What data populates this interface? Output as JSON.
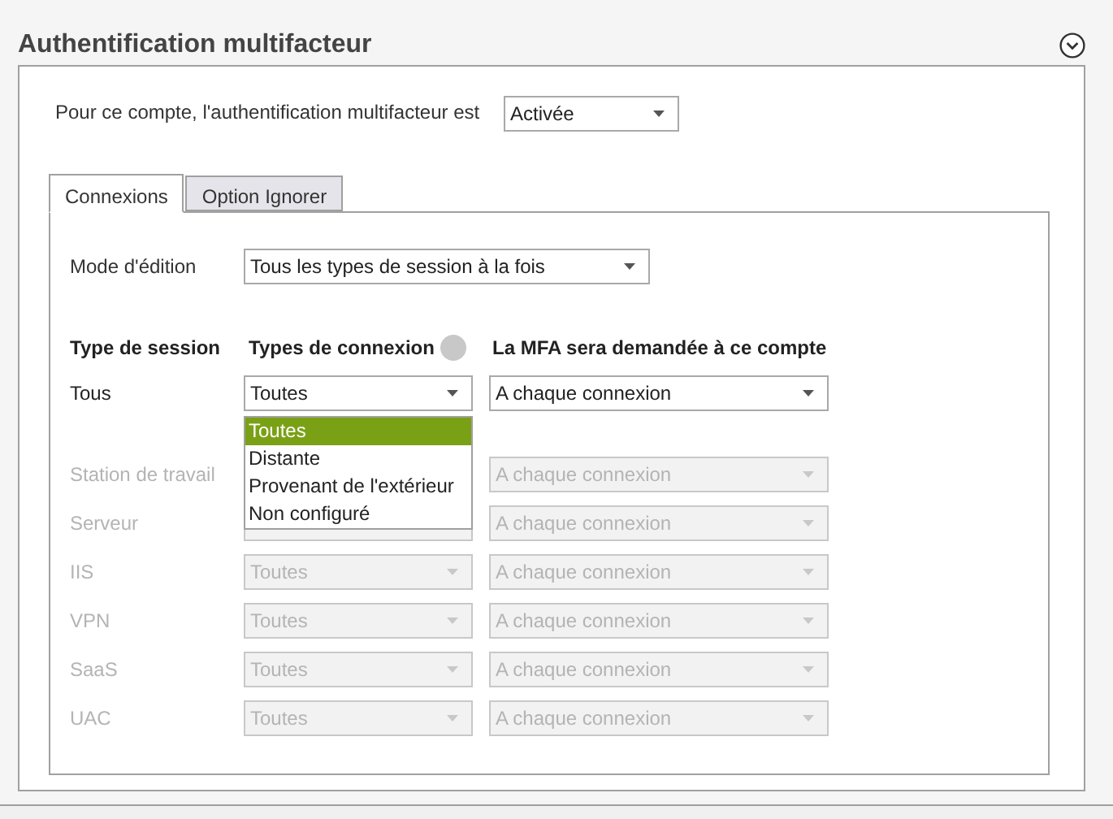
{
  "section": {
    "title": "Authentification multifacteur",
    "expanded": true
  },
  "account": {
    "label": "Pour ce compte, l'authentification multifacteur est",
    "value": "Activée"
  },
  "tabs": [
    {
      "label": "Connexions",
      "selected": true
    },
    {
      "label": "Option Ignorer",
      "selected": false
    }
  ],
  "edit_mode": {
    "label": "Mode d'édition",
    "value": "Tous les types de session à la fois"
  },
  "table": {
    "columns": [
      "Type de session",
      "Types de connexion",
      "La MFA sera demandée à ce compte"
    ],
    "rows": [
      {
        "session": "Tous",
        "connection": "Toutes",
        "mfa": "A chaque connexion",
        "disabled": false
      },
      {
        "session": "Station de travail",
        "mfa": "A chaque connexion",
        "disabled": true
      },
      {
        "session": "Serveur",
        "mfa": "A chaque connexion",
        "disabled": true
      },
      {
        "session": "IIS",
        "connection": "Toutes",
        "mfa": "A chaque connexion",
        "disabled": true
      },
      {
        "session": "VPN",
        "connection": "Toutes",
        "mfa": "A chaque connexion",
        "disabled": true
      },
      {
        "session": "SaaS",
        "connection": "Toutes",
        "mfa": "A chaque connexion",
        "disabled": true
      },
      {
        "session": "UAC",
        "connection": "Toutes",
        "mfa": "A chaque connexion",
        "disabled": true
      }
    ]
  },
  "connection_menu": [
    {
      "label": "Toutes",
      "selected": true
    },
    {
      "label": "Distante",
      "selected": false
    },
    {
      "label": "Provenant de l'extérieur",
      "selected": false
    },
    {
      "label": "Non configuré",
      "selected": false
    }
  ]
}
